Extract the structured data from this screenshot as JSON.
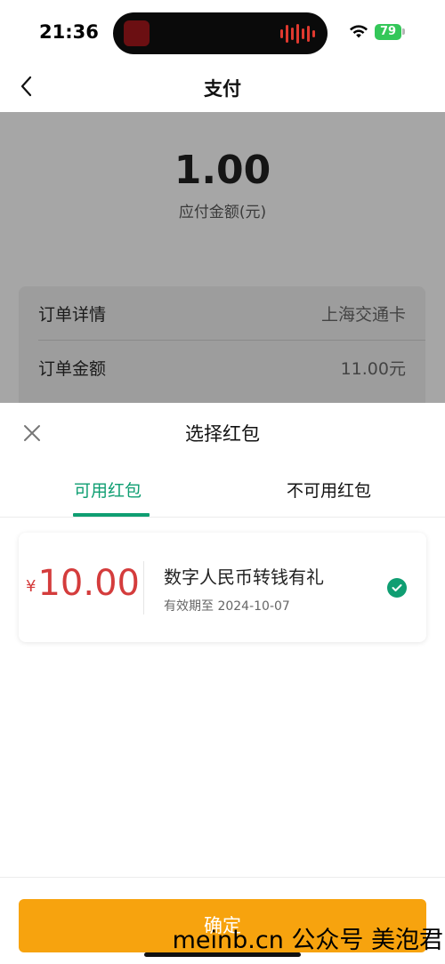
{
  "status_bar": {
    "time": "21:36",
    "battery": "79"
  },
  "nav": {
    "title": "支付"
  },
  "payment": {
    "amount": "1.00",
    "amount_label": "应付金额(元)"
  },
  "order": {
    "rows": [
      {
        "label": "订单详情",
        "value": "上海交通卡"
      },
      {
        "label": "订单金额",
        "value": "11.00元"
      }
    ]
  },
  "sheet": {
    "title": "选择红包",
    "tabs": [
      {
        "label": "可用红包",
        "active": true
      },
      {
        "label": "不可用红包",
        "active": false
      }
    ],
    "coupons": [
      {
        "currency": "¥",
        "amount": "10.00",
        "name": "数字人民币转钱有礼",
        "expiry": "有效期至  2024-10-07",
        "selected": true
      }
    ],
    "confirm_label": "确定"
  },
  "watermark": "meinb.cn  公众号 美泡君",
  "colors": {
    "accent": "#0f9e72",
    "price": "#d43c3c",
    "confirm": "#f7a30e"
  }
}
